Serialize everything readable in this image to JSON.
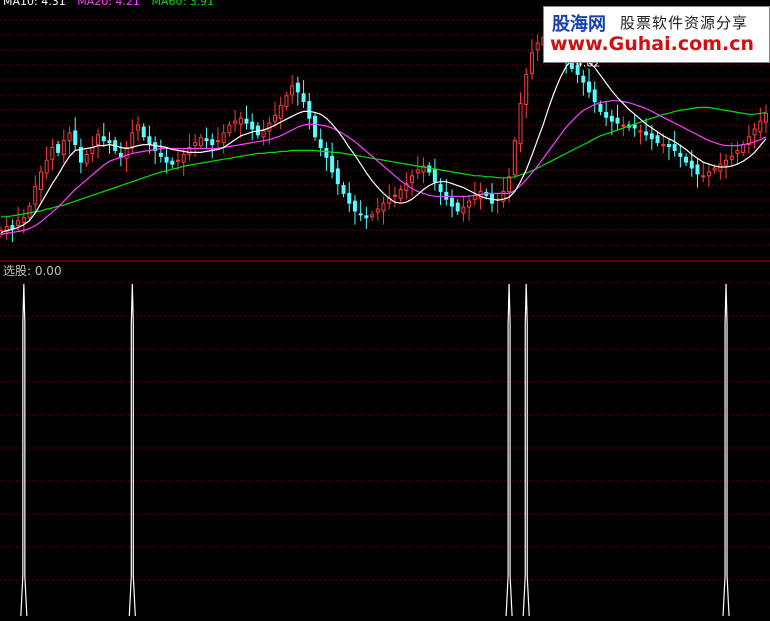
{
  "colors": {
    "background": "#000000",
    "grid": "#800000",
    "separator": "#c00000",
    "candle_up": "#ff3c3c",
    "candle_down": "#54ffff",
    "ma10": "#ffffff",
    "ma20": "#ff40ff",
    "ma60": "#00e000",
    "signal": "#ffffff"
  },
  "legend": {
    "ma10": "MA10: 4.31",
    "ma20": "MA20: 4.21",
    "ma60": "MA60: 3.91"
  },
  "price_panel": {
    "peak_label": "4.82",
    "peak_index": 100
  },
  "indicator_panel": {
    "label": "选股: 0.00"
  },
  "watermark": {
    "logo": "股海网",
    "slogan": "股票软件资源分享",
    "url": "www.Guhai.com.cn"
  },
  "chart_data": [
    {
      "type": "candlestick",
      "title": "",
      "series": [
        {
          "name": "MA10",
          "value": 4.31
        },
        {
          "name": "MA20",
          "value": 4.21
        },
        {
          "name": "MA60",
          "value": 3.91
        }
      ],
      "ylim": [
        2.5,
        5.0
      ],
      "grid": true,
      "close": [
        2.7,
        2.74,
        2.72,
        2.8,
        2.83,
        2.95,
        3.15,
        3.3,
        3.42,
        3.55,
        3.5,
        3.62,
        3.7,
        3.58,
        3.4,
        3.48,
        3.55,
        3.68,
        3.62,
        3.6,
        3.52,
        3.45,
        3.55,
        3.7,
        3.78,
        3.66,
        3.58,
        3.52,
        3.46,
        3.4,
        3.38,
        3.42,
        3.48,
        3.55,
        3.6,
        3.65,
        3.62,
        3.58,
        3.62,
        3.7,
        3.78,
        3.82,
        3.85,
        3.8,
        3.74,
        3.68,
        3.72,
        3.8,
        3.88,
        3.98,
        4.08,
        4.18,
        4.12,
        4.02,
        3.85,
        3.66,
        3.55,
        3.45,
        3.3,
        3.18,
        3.08,
        2.98,
        2.9,
        2.86,
        2.83,
        2.86,
        2.92,
        2.98,
        3.03,
        3.06,
        3.12,
        3.18,
        3.26,
        3.32,
        3.36,
        3.3,
        3.2,
        3.1,
        3.02,
        2.95,
        2.9,
        2.94,
        3.0,
        3.06,
        3.1,
        3.06,
        2.98,
        3.02,
        3.1,
        3.25,
        3.62,
        4.0,
        4.3,
        4.52,
        4.62,
        4.68,
        4.72,
        4.62,
        4.5,
        4.42,
        4.36,
        4.3,
        4.22,
        4.12,
        4.02,
        3.92,
        3.86,
        3.82,
        3.8,
        3.78,
        3.76,
        3.75,
        3.72,
        3.68,
        3.64,
        3.6,
        3.58,
        3.56,
        3.52,
        3.46,
        3.4,
        3.34,
        3.28,
        3.26,
        3.3,
        3.34,
        3.38,
        3.42,
        3.46,
        3.52,
        3.58,
        3.66,
        3.74,
        3.82,
        3.9
      ],
      "ma10": [
        2.68,
        2.7,
        2.71,
        2.73,
        2.76,
        2.8,
        2.88,
        2.98,
        3.08,
        3.18,
        3.27,
        3.37,
        3.46,
        3.52,
        3.53,
        3.54,
        3.55,
        3.57,
        3.57,
        3.58,
        3.57,
        3.55,
        3.54,
        3.55,
        3.57,
        3.58,
        3.58,
        3.57,
        3.56,
        3.55,
        3.53,
        3.52,
        3.51,
        3.5,
        3.5,
        3.5,
        3.51,
        3.52,
        3.53,
        3.55,
        3.59,
        3.63,
        3.67,
        3.69,
        3.71,
        3.72,
        3.73,
        3.75,
        3.78,
        3.81,
        3.84,
        3.87,
        3.9,
        3.92,
        3.92,
        3.91,
        3.89,
        3.85,
        3.79,
        3.72,
        3.64,
        3.55,
        3.47,
        3.38,
        3.29,
        3.21,
        3.14,
        3.08,
        3.03,
        2.99,
        2.98,
        2.99,
        3.02,
        3.07,
        3.12,
        3.16,
        3.19,
        3.2,
        3.2,
        3.18,
        3.16,
        3.14,
        3.11,
        3.08,
        3.05,
        3.03,
        3.02,
        3.01,
        3.02,
        3.04,
        3.1,
        3.2,
        3.32,
        3.47,
        3.63,
        3.79,
        3.97,
        4.13,
        4.27,
        4.38,
        4.45,
        4.47,
        4.46,
        4.42,
        4.37,
        4.29,
        4.21,
        4.13,
        4.06,
        4.0,
        3.94,
        3.89,
        3.84,
        3.79,
        3.75,
        3.71,
        3.67,
        3.64,
        3.61,
        3.57,
        3.53,
        3.48,
        3.44,
        3.4,
        3.38,
        3.36,
        3.35,
        3.35,
        3.36,
        3.38,
        3.41,
        3.45,
        3.5,
        3.57,
        3.64
      ],
      "ma20": [
        2.66,
        2.67,
        2.68,
        2.69,
        2.7,
        2.72,
        2.75,
        2.79,
        2.84,
        2.89,
        2.94,
        3.0,
        3.06,
        3.12,
        3.17,
        3.22,
        3.27,
        3.32,
        3.37,
        3.41,
        3.43,
        3.45,
        3.47,
        3.49,
        3.5,
        3.51,
        3.52,
        3.53,
        3.54,
        3.54,
        3.54,
        3.54,
        3.54,
        3.54,
        3.54,
        3.54,
        3.54,
        3.54,
        3.54,
        3.55,
        3.56,
        3.57,
        3.58,
        3.59,
        3.6,
        3.61,
        3.62,
        3.63,
        3.65,
        3.67,
        3.7,
        3.73,
        3.76,
        3.78,
        3.79,
        3.79,
        3.78,
        3.77,
        3.75,
        3.72,
        3.69,
        3.65,
        3.61,
        3.56,
        3.51,
        3.46,
        3.41,
        3.36,
        3.31,
        3.26,
        3.21,
        3.17,
        3.13,
        3.1,
        3.08,
        3.06,
        3.05,
        3.05,
        3.05,
        3.05,
        3.05,
        3.05,
        3.05,
        3.06,
        3.07,
        3.08,
        3.08,
        3.08,
        3.08,
        3.08,
        3.11,
        3.16,
        3.22,
        3.29,
        3.36,
        3.44,
        3.52,
        3.6,
        3.68,
        3.76,
        3.82,
        3.88,
        3.93,
        3.96,
        3.99,
        4.01,
        4.02,
        4.03,
        4.03,
        4.02,
        4.01,
        3.99,
        3.97,
        3.95,
        3.92,
        3.89,
        3.86,
        3.83,
        3.8,
        3.77,
        3.74,
        3.71,
        3.68,
        3.65,
        3.62,
        3.6,
        3.58,
        3.57,
        3.57,
        3.57,
        3.58,
        3.59,
        3.61,
        3.63,
        3.66
      ],
      "ma60": [
        2.84,
        2.84,
        2.85,
        2.86,
        2.87,
        2.88,
        2.89,
        2.9,
        2.92,
        2.93,
        2.95,
        2.96,
        2.98,
        3.0,
        3.02,
        3.04,
        3.06,
        3.08,
        3.1,
        3.12,
        3.14,
        3.16,
        3.18,
        3.2,
        3.22,
        3.24,
        3.26,
        3.28,
        3.3,
        3.31,
        3.33,
        3.34,
        3.36,
        3.37,
        3.38,
        3.39,
        3.4,
        3.41,
        3.42,
        3.43,
        3.44,
        3.45,
        3.46,
        3.47,
        3.48,
        3.49,
        3.49,
        3.5,
        3.5,
        3.51,
        3.51,
        3.52,
        3.52,
        3.52,
        3.52,
        3.52,
        3.51,
        3.51,
        3.5,
        3.5,
        3.49,
        3.48,
        3.47,
        3.46,
        3.45,
        3.44,
        3.43,
        3.42,
        3.41,
        3.4,
        3.39,
        3.38,
        3.37,
        3.36,
        3.35,
        3.34,
        3.33,
        3.32,
        3.31,
        3.3,
        3.29,
        3.28,
        3.27,
        3.26,
        3.26,
        3.25,
        3.25,
        3.24,
        3.24,
        3.24,
        3.25,
        3.27,
        3.29,
        3.31,
        3.34,
        3.37,
        3.4,
        3.43,
        3.46,
        3.49,
        3.52,
        3.55,
        3.58,
        3.61,
        3.64,
        3.67,
        3.69,
        3.71,
        3.73,
        3.75,
        3.77,
        3.79,
        3.81,
        3.83,
        3.85,
        3.87,
        3.89,
        3.9,
        3.92,
        3.93,
        3.94,
        3.95,
        3.96,
        3.96,
        3.96,
        3.95,
        3.94,
        3.93,
        3.92,
        3.91,
        3.9,
        3.89,
        3.89,
        3.9,
        3.91
      ]
    },
    {
      "type": "line",
      "title": "",
      "series": [
        {
          "name": "选股",
          "value": 0.0
        }
      ],
      "ylim": [
        0,
        1
      ],
      "signal_indices": [
        4,
        23,
        89,
        92,
        127
      ]
    }
  ]
}
